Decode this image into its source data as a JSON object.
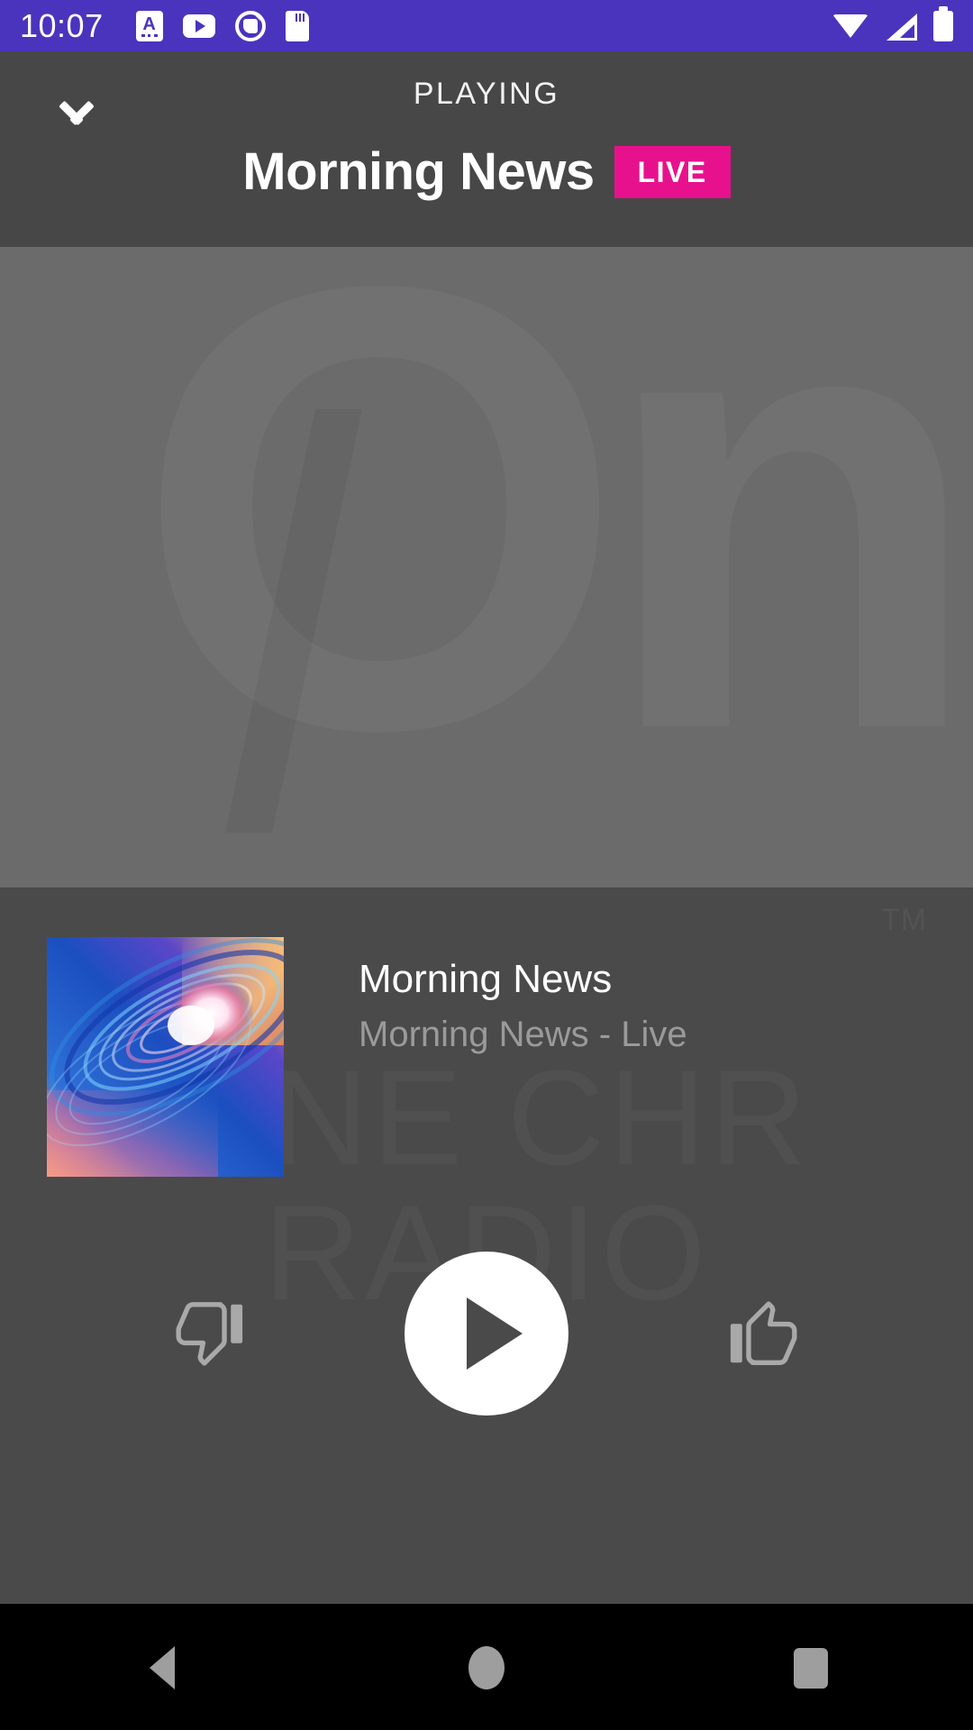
{
  "status_bar": {
    "time": "10:07",
    "background_color": "#4a34bd",
    "notification_icons": [
      "spellcheck-icon",
      "youtube-icon",
      "app-circle-icon",
      "sd-card-icon"
    ],
    "system_icons": [
      "wifi-icon",
      "cellular-signal-icon",
      "battery-icon"
    ]
  },
  "header": {
    "collapse_icon": "chevron-down-icon",
    "eyebrow": "PLAYING",
    "title": "Morning News",
    "badge": "LIVE",
    "badge_color": "#e8118d",
    "background_color": "#474747"
  },
  "artwork_area": {
    "watermark_logo": "One",
    "trademark": "TM",
    "background_color": "#6b6b6b"
  },
  "now_playing": {
    "album_art_name": "album-art-spiral-vortex",
    "title": "Morning News",
    "subtitle": "Morning News - Live",
    "background_color": "#4a4a4a",
    "watermark_text": "ONE CHR RADIO"
  },
  "controls": {
    "thumbs_down": "thumb-down-icon",
    "play": "play-icon",
    "thumbs_up": "thumb-up-icon"
  },
  "nav_bar": {
    "back": "back-triangle-icon",
    "home": "home-circle-icon",
    "recents": "recents-square-icon"
  }
}
